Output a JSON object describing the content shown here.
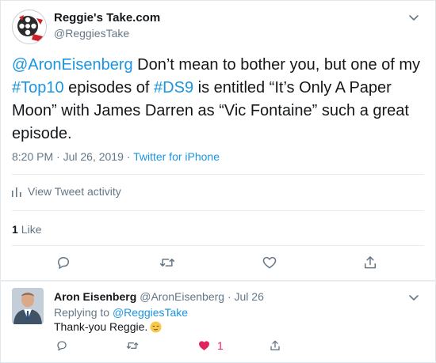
{
  "main_tweet": {
    "display_name": "Reggie's Take.com",
    "handle": "@ReggiesTake",
    "text_parts": {
      "mention": "@AronEisenberg",
      "t1": " Don’t mean to bother you, but one of my ",
      "hashtag1": "#Top10",
      "t2": " episodes of ",
      "hashtag2": "#DS9",
      "t3": " is entitled “It’s Only A Paper Moon” with James Darren as “Vic Fontaine” such a great episode."
    },
    "timestamp": "8:20 PM · Jul 26, 2019 · ",
    "source": "Twitter for iPhone",
    "activity_label": "View Tweet activity",
    "like_count": "1",
    "like_label": "Like"
  },
  "reply": {
    "display_name": "Aron Eisenberg",
    "handle_date": "@AronEisenberg · Jul 26",
    "replying_prefix": "Replying to ",
    "replying_handle": "@ReggiesTake",
    "text": "Thank-you Reggie.",
    "like_count": "1"
  },
  "icons": {
    "reply": "reply-icon",
    "retweet": "retweet-icon",
    "like": "heart-icon",
    "share": "share-icon",
    "caret": "chevron-down-icon",
    "activity": "bar-chart-icon",
    "emoji": "relieved-face-emoji"
  },
  "colors": {
    "link": "#1b95e0",
    "secondary_text": "#657786",
    "primary_text": "#14171a",
    "liked": "#e0245e",
    "divider": "#e6ecf0"
  }
}
